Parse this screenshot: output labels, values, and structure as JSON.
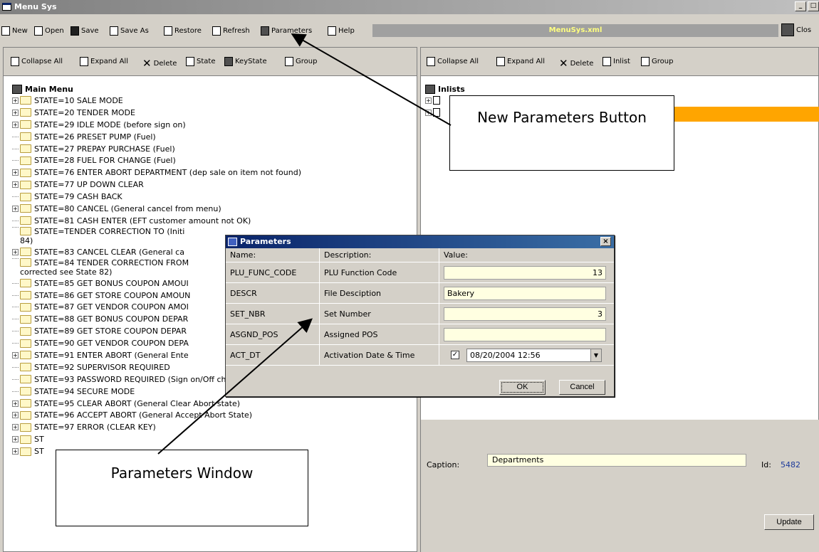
{
  "window": {
    "title": "Menu Sys",
    "controls": [
      "_",
      "□"
    ]
  },
  "toolbar": {
    "items": [
      "New",
      "Open",
      "Save",
      "Save As",
      "Restore",
      "Refresh",
      "Parameters",
      "Help"
    ],
    "file": "MenuSys.xml",
    "close_label": "Clos"
  },
  "left_pane": {
    "toolbar": [
      "Collapse All",
      "Expand All",
      "Delete",
      "State",
      "KeyState",
      "Group"
    ],
    "root": "Main Menu",
    "nodes": [
      {
        "label": "STATE=10 SALE MODE",
        "expand": true
      },
      {
        "label": "STATE=20 TENDER MODE",
        "expand": true
      },
      {
        "label": "STATE=29 IDLE MODE (before sign on)",
        "expand": true
      },
      {
        "label": "STATE=26 PRESET PUMP (Fuel)",
        "expand": false
      },
      {
        "label": "STATE=27 PREPAY PURCHASE (Fuel)",
        "expand": false
      },
      {
        "label": "STATE=28 FUEL FOR CHANGE (Fuel)",
        "expand": false
      },
      {
        "label": "STATE=76 ENTER ABORT DEPARTMENT (dep sale on item not found)",
        "expand": true
      },
      {
        "label": "STATE=77 UP DOWN CLEAR",
        "expand": true
      },
      {
        "label": "STATE=79 CASH BACK",
        "expand": false
      },
      {
        "label": "STATE=80 CANCEL (General cancel from menu)",
        "expand": true
      },
      {
        "label": "STATE=81 CASH ENTER (EFT customer amount not OK)",
        "expand": false
      },
      {
        "label": "STATE=TENDER CORRECTION TO (Initi",
        "label2": "84)",
        "expand": false
      },
      {
        "label": "STATE=83 CANCEL CLEAR (General ca",
        "expand": true
      },
      {
        "label": "STATE=84 TENDER CORRECTION FROM",
        "label2": "corrected see State 82)",
        "expand": false
      },
      {
        "label": "STATE=85 GET BONUS COUPON AMOUI",
        "expand": false
      },
      {
        "label": "STATE=86 GET STORE COUPON AMOUN",
        "expand": false
      },
      {
        "label": "STATE=87 GET VENDOR COUPON AMOI",
        "expand": false
      },
      {
        "label": "STATE=88 GET BONUS COUPON DEPAR",
        "expand": false
      },
      {
        "label": "STATE=89 GET STORE COUPON DEPAR",
        "expand": false
      },
      {
        "label": "STATE=90 GET VENDOR COUPON DEPA",
        "expand": false
      },
      {
        "label": "STATE=91 ENTER ABORT (General Ente",
        "expand": true
      },
      {
        "label": "STATE=92 SUPERVISOR REQUIRED",
        "expand": false
      },
      {
        "label": "STATE=93 PASSWORD REQUIRED (Sign on/Off change etc)",
        "expand": false
      },
      {
        "label": "STATE=94 SECURE MODE",
        "expand": false
      },
      {
        "label": "STATE=95 CLEAR ABORT (General Clear Abort state)",
        "expand": true
      },
      {
        "label": "STATE=96 ACCEPT ABORT (General Accept Abort State)",
        "expand": true
      },
      {
        "label": "STATE=97 ERROR (CLEAR KEY)",
        "expand": true
      },
      {
        "label": "ST",
        "expand": true
      },
      {
        "label": "ST",
        "expand": true
      }
    ]
  },
  "right_pane": {
    "toolbar": [
      "Collapse All",
      "Expand All",
      "Delete",
      "Inlist",
      "Group"
    ],
    "root": "Inlists"
  },
  "detail": {
    "caption_label": "Caption:",
    "caption_value": "Departments",
    "id_label": "Id:",
    "id_value": "5482",
    "update_label": "Update"
  },
  "dialog": {
    "title": "Parameters",
    "close": "×",
    "headers": {
      "name": "Name:",
      "description": "Description:",
      "value": "Value:"
    },
    "rows": [
      {
        "name": "PLU_FUNC_CODE",
        "description": "PLU Function Code",
        "value": "13"
      },
      {
        "name": "DESCR",
        "description": "File Desciption",
        "value": "Bakery"
      },
      {
        "name": "SET_NBR",
        "description": "Set Number",
        "value": "3"
      },
      {
        "name": "ASGND_POS",
        "description": "Assigned POS",
        "value": ""
      },
      {
        "name": "ACT_DT",
        "description": "Activation Date & Time",
        "value": "08/20/2004 12:56"
      }
    ],
    "ok": "OK",
    "cancel": "Cancel"
  },
  "callouts": {
    "params_button": "New Parameters Button",
    "params_window": "Parameters Window"
  }
}
